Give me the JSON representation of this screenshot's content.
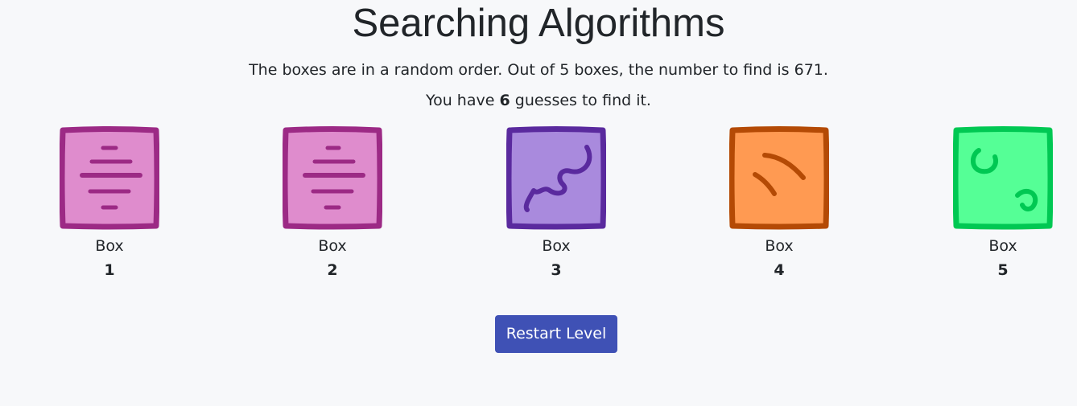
{
  "page": {
    "title": "Searching Algorithms",
    "description": "The boxes are in a random order. Out of 5 boxes, the number to find is 671.",
    "guesses_prefix": "You have",
    "guesses_count": "6",
    "guesses_suffix": "guesses to find it."
  },
  "boxes": [
    {
      "label": "Box",
      "number": "1",
      "fill": "#df8ccd",
      "stroke": "#9c2a85",
      "icon": "horizontal-lines-icon"
    },
    {
      "label": "Box",
      "number": "2",
      "fill": "#df8ccd",
      "stroke": "#9c2a85",
      "icon": "horizontal-lines-icon"
    },
    {
      "label": "Box",
      "number": "3",
      "fill": "#a98add",
      "stroke": "#5a2a9e",
      "icon": "squiggle-icon"
    },
    {
      "label": "Box",
      "number": "4",
      "fill": "#ff9a52",
      "stroke": "#b44a05",
      "icon": "diagonal-strokes-icon"
    },
    {
      "label": "Box",
      "number": "5",
      "fill": "#55ff96",
      "stroke": "#00c853",
      "icon": "curls-icon"
    }
  ],
  "actions": {
    "restart_label": "Restart Level"
  },
  "colors": {
    "background": "#f7f8fa",
    "button": "#3f51b5",
    "text": "#212529"
  }
}
